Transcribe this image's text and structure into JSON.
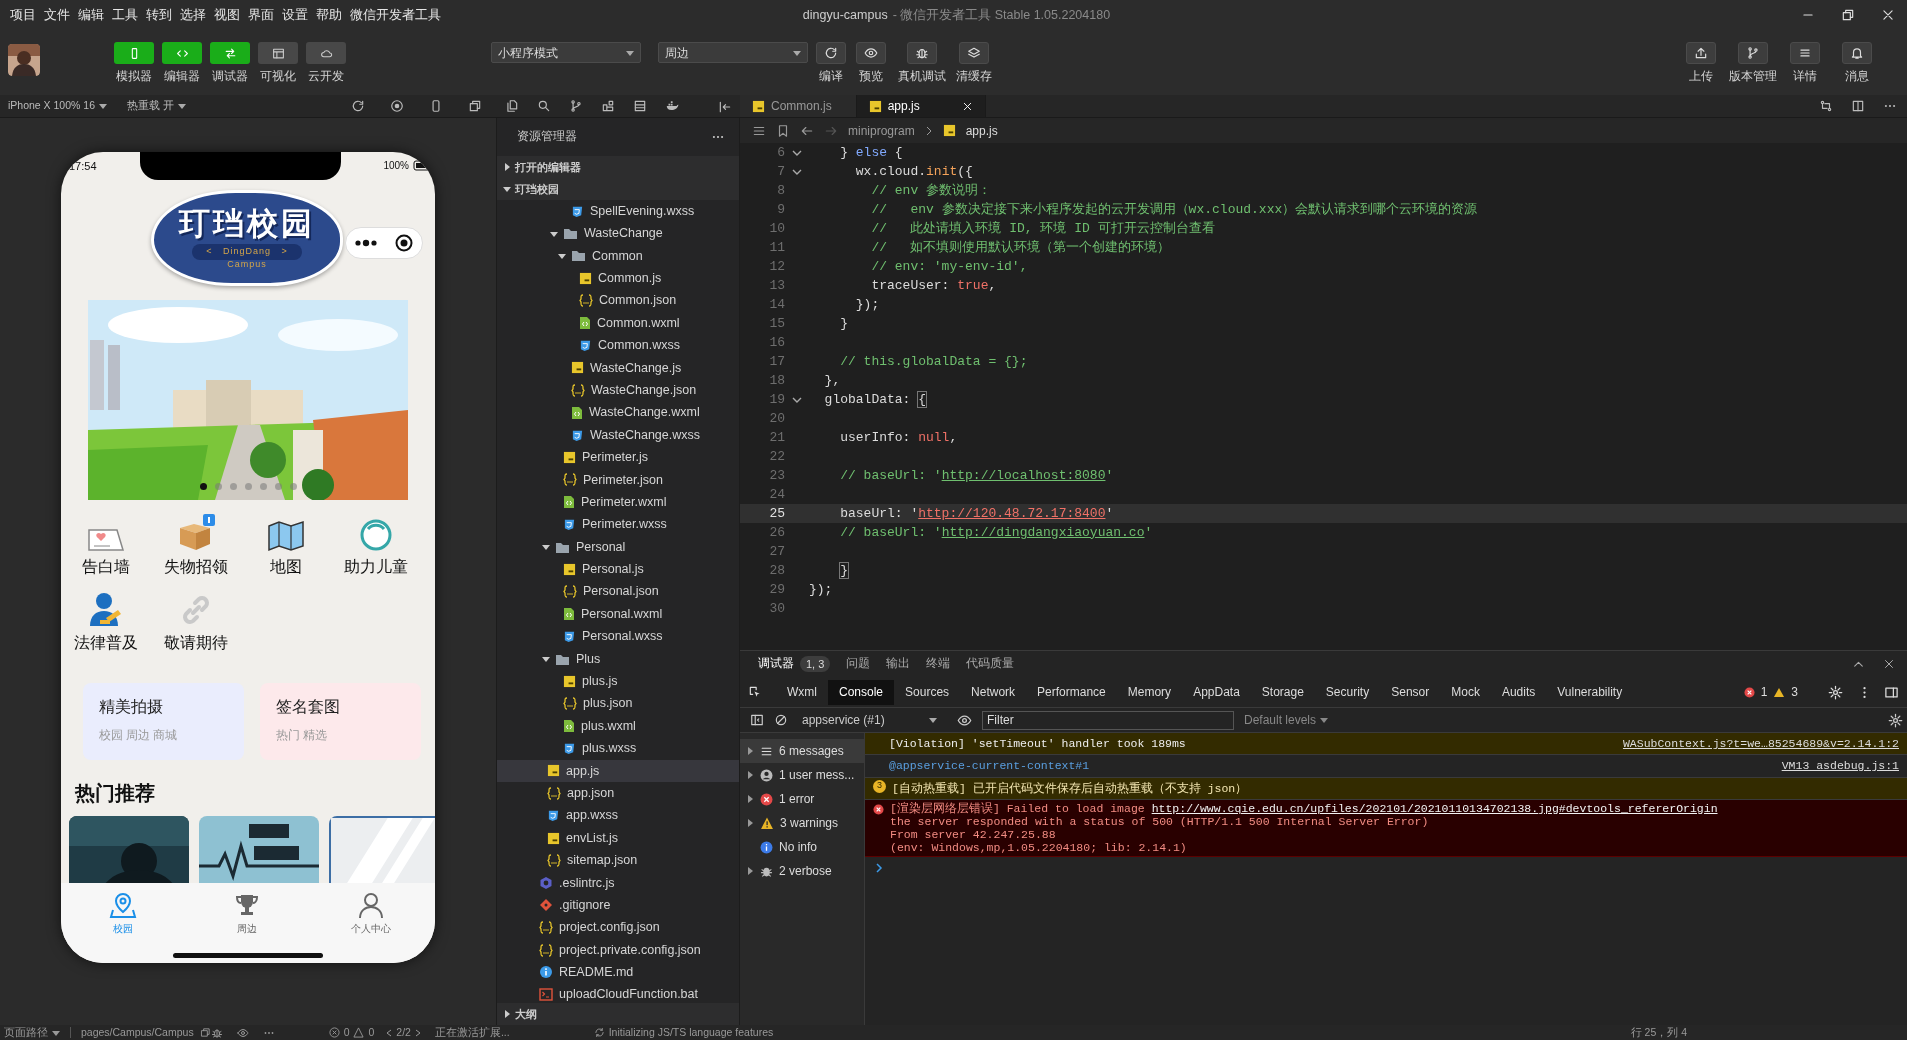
{
  "menu": [
    "项目",
    "文件",
    "编辑",
    "工具",
    "转到",
    "选择",
    "视图",
    "界面",
    "设置",
    "帮助",
    "微信开发者工具"
  ],
  "window": {
    "title": "dingyu-campus",
    "subtitle": "- 微信开发者工具 Stable 1.05.2204180"
  },
  "toolbar": {
    "modes": [
      {
        "label": "模拟器",
        "on": true
      },
      {
        "label": "编辑器",
        "on": true
      },
      {
        "label": "调试器",
        "on": true
      },
      {
        "label": "可视化",
        "on": false
      },
      {
        "label": "云开发",
        "on": false
      }
    ],
    "selects": [
      {
        "value": "小程序模式"
      },
      {
        "value": "周边"
      }
    ],
    "actions": [
      {
        "label": "编译"
      },
      {
        "label": "预览"
      },
      {
        "label": "真机调试"
      },
      {
        "label": "清缓存"
      }
    ],
    "right_actions": [
      {
        "label": "上传"
      },
      {
        "label": "版本管理"
      },
      {
        "label": "详情"
      },
      {
        "label": "消息"
      }
    ]
  },
  "simulator": {
    "device": "iPhone X 100% 16",
    "hot_reload": "热重载 开"
  },
  "phone": {
    "time": "17:54",
    "battery": "100%",
    "logo": {
      "title": "玎珰校园",
      "subtitle": "<   DingDang   >",
      "tagline": "Campus"
    },
    "banner": {
      "kind": "picture",
      "dots": [
        {
          "selected": true
        },
        {
          "selected": false
        },
        {
          "selected": false
        },
        {
          "selected": false
        },
        {
          "selected": false
        },
        {
          "selected": false
        },
        {
          "selected": false
        }
      ]
    },
    "grid": [
      {
        "label": "告白墙"
      },
      {
        "label": "失物招领"
      },
      {
        "label": "地图"
      },
      {
        "label": "助力儿童"
      },
      {
        "label": "法律普及"
      },
      {
        "label": "敬请期待"
      }
    ],
    "cards": [
      {
        "title": "精美拍摄",
        "tags": "校园 周边 商城",
        "color": "#eaedfd"
      },
      {
        "title": "签名套图",
        "tags": "热门 精选",
        "color": "#fde9eb"
      }
    ],
    "section_title": "热门推荐",
    "tabs": [
      {
        "label": "校园",
        "selected": true
      },
      {
        "label": "周边",
        "selected": false
      },
      {
        "label": "个人中心",
        "selected": false
      }
    ]
  },
  "explorer": {
    "title": "资源管理器",
    "sections": [
      {
        "label": "打开的编辑器",
        "expanded": false
      },
      {
        "label": "玎珰校园",
        "expanded": true
      }
    ],
    "tree": [
      {
        "kind": "group",
        "children": [
          {
            "kind": "group",
            "children": [
              {
                "kind": "group",
                "children": [
                  {
                    "kind": "group",
                    "children": [
                      {
                        "label": "SpellEvening.wxss",
                        "kind": "wxss",
                        "selected": false
                      }
                    ]
                  },
                  {
                    "label": "WasteChange",
                    "kind": "folder",
                    "expanded": true,
                    "selected": false,
                    "children": [
                      {
                        "label": "Common",
                        "kind": "folder",
                        "expanded": true,
                        "selected": false,
                        "children": [
                          {
                            "label": "Common.js",
                            "kind": "js",
                            "selected": false
                          },
                          {
                            "label": "Common.json",
                            "kind": "json",
                            "selected": false
                          },
                          {
                            "label": "Common.wxml",
                            "kind": "wxml",
                            "selected": false
                          },
                          {
                            "label": "Common.wxss",
                            "kind": "wxss",
                            "selected": false
                          }
                        ]
                      },
                      {
                        "label": "WasteChange.js",
                        "kind": "js",
                        "selected": false
                      },
                      {
                        "label": "WasteChange.json",
                        "kind": "json",
                        "selected": false
                      },
                      {
                        "label": "WasteChange.wxml",
                        "kind": "wxml",
                        "selected": false
                      },
                      {
                        "label": "WasteChange.wxss",
                        "kind": "wxss",
                        "selected": false
                      }
                    ]
                  },
                  {
                    "label": "Perimeter.js",
                    "kind": "js",
                    "selected": false
                  },
                  {
                    "label": "Perimeter.json",
                    "kind": "json",
                    "selected": false
                  },
                  {
                    "label": "Perimeter.wxml",
                    "kind": "wxml",
                    "selected": false
                  },
                  {
                    "label": "Perimeter.wxss",
                    "kind": "wxss",
                    "selected": false
                  }
                ]
              },
              {
                "label": "Personal",
                "kind": "folder",
                "expanded": true,
                "selected": false,
                "children": [
                  {
                    "label": "Personal.js",
                    "kind": "js",
                    "selected": false
                  },
                  {
                    "label": "Personal.json",
                    "kind": "json",
                    "selected": false
                  },
                  {
                    "label": "Personal.wxml",
                    "kind": "wxml",
                    "selected": false
                  },
                  {
                    "label": "Personal.wxss",
                    "kind": "wxss",
                    "selected": false
                  }
                ]
              },
              {
                "label": "Plus",
                "kind": "folder",
                "expanded": true,
                "selected": false,
                "children": [
                  {
                    "label": "plus.js",
                    "kind": "js",
                    "selected": false
                  },
                  {
                    "label": "plus.json",
                    "kind": "json",
                    "selected": false
                  },
                  {
                    "label": "plus.wxml",
                    "kind": "wxml",
                    "selected": false
                  },
                  {
                    "label": "plus.wxss",
                    "kind": "wxss",
                    "selected": false
                  }
                ]
              }
            ]
          },
          {
            "label": "app.js",
            "kind": "js",
            "selected": true
          },
          {
            "label": "app.json",
            "kind": "json",
            "selected": false
          },
          {
            "label": "app.wxss",
            "kind": "wxss",
            "selected": false
          },
          {
            "label": "envList.js",
            "kind": "js",
            "selected": false
          },
          {
            "label": "sitemap.json",
            "kind": "json",
            "selected": false
          }
        ]
      },
      {
        "label": ".eslintrc.js",
        "kind": "eslint",
        "selected": false
      },
      {
        "label": ".gitignore",
        "kind": "git",
        "selected": false
      },
      {
        "label": "project.config.json",
        "kind": "json",
        "selected": false
      },
      {
        "label": "project.private.config.json",
        "kind": "json",
        "selected": false
      },
      {
        "label": "README.md",
        "kind": "md",
        "selected": false
      },
      {
        "label": "uploadCloudFunction.bat",
        "kind": "bat",
        "selected": false
      }
    ],
    "outline": {
      "label": "大纲",
      "expanded": false
    }
  },
  "editor": {
    "tabs": [
      {
        "label": "Common.js",
        "selected": false
      },
      {
        "label": "app.js",
        "selected": true
      }
    ],
    "breadcrumb": [
      "miniprogram",
      "app.js"
    ],
    "lines": [
      {
        "num": "6",
        "fold": true,
        "current": false,
        "segs": [
          {
            "kind": "plain",
            "text": "    } "
          },
          {
            "kind": "keyword",
            "text": "else"
          },
          {
            "kind": "plain",
            "text": " {"
          }
        ]
      },
      {
        "num": "7",
        "fold": true,
        "current": false,
        "segs": [
          {
            "kind": "plain",
            "text": "      wx.cloud."
          },
          {
            "kind": "func",
            "text": "init"
          },
          {
            "kind": "plain",
            "text": "({"
          }
        ]
      },
      {
        "num": "8",
        "fold": false,
        "current": false,
        "segs": [
          {
            "kind": "comment",
            "text": "        // env 参数说明："
          }
        ]
      },
      {
        "num": "9",
        "fold": false,
        "current": false,
        "segs": [
          {
            "kind": "comment",
            "text": "        //   env 参数决定接下来小程序发起的云开发调用（wx.cloud.xxx）会默认请求到哪个云环境的资源"
          }
        ]
      },
      {
        "num": "10",
        "fold": false,
        "current": false,
        "segs": [
          {
            "kind": "comment",
            "text": "        //   此处请填入环境 ID, 环境 ID 可打开云控制台查看"
          }
        ]
      },
      {
        "num": "11",
        "fold": false,
        "current": false,
        "segs": [
          {
            "kind": "comment",
            "text": "        //   如不填则使用默认环境（第一个创建的环境）"
          }
        ]
      },
      {
        "num": "12",
        "fold": false,
        "current": false,
        "segs": [
          {
            "kind": "comment",
            "text": "        // env: 'my-env-id',"
          }
        ]
      },
      {
        "num": "13",
        "fold": false,
        "current": false,
        "segs": [
          {
            "kind": "plain",
            "text": "        traceUser: "
          },
          {
            "kind": "literal",
            "text": "true"
          },
          {
            "kind": "plain",
            "text": ","
          }
        ]
      },
      {
        "num": "14",
        "fold": false,
        "current": false,
        "segs": [
          {
            "kind": "plain",
            "text": "      });"
          }
        ]
      },
      {
        "num": "15",
        "fold": false,
        "current": false,
        "segs": [
          {
            "kind": "plain",
            "text": "    }"
          }
        ]
      },
      {
        "num": "16",
        "fold": false,
        "current": false
      },
      {
        "num": "17",
        "fold": false,
        "current": false,
        "segs": [
          {
            "kind": "comment",
            "text": "    // this.globalData = {};"
          }
        ]
      },
      {
        "num": "18",
        "fold": false,
        "current": false,
        "segs": [
          {
            "kind": "plain",
            "text": "  },"
          }
        ]
      },
      {
        "num": "19",
        "fold": true,
        "current": false,
        "segs": [
          {
            "kind": "plain",
            "text": "  globalData: "
          },
          {
            "kind": "bracket",
            "text": "{"
          }
        ]
      },
      {
        "num": "20",
        "fold": false,
        "current": false
      },
      {
        "num": "21",
        "fold": false,
        "current": false,
        "segs": [
          {
            "kind": "plain",
            "text": "    userInfo: "
          },
          {
            "kind": "literal",
            "text": "null"
          },
          {
            "kind": "plain",
            "text": ","
          }
        ]
      },
      {
        "num": "22",
        "fold": false,
        "current": false
      },
      {
        "num": "23",
        "fold": false,
        "current": false,
        "segs": [
          {
            "kind": "comment",
            "text": "    // baseUrl: '"
          },
          {
            "kind": "comment_link",
            "text": "http://localhost:8080"
          },
          {
            "kind": "comment",
            "text": "'"
          }
        ]
      },
      {
        "num": "24",
        "fold": false,
        "current": false
      },
      {
        "num": "25",
        "fold": false,
        "current": true,
        "segs": [
          {
            "kind": "plain",
            "text": "    baseUrl: '"
          },
          {
            "kind": "string_link",
            "text": "http://120.48.72.17:8400"
          },
          {
            "kind": "plain",
            "text": "'"
          }
        ]
      },
      {
        "num": "26",
        "fold": false,
        "current": false,
        "segs": [
          {
            "kind": "comment",
            "text": "    // baseUrl: '"
          },
          {
            "kind": "comment_link",
            "text": "http://dingdangxiaoyuan.co"
          },
          {
            "kind": "comment",
            "text": "'"
          }
        ]
      },
      {
        "num": "27",
        "fold": false,
        "current": false
      },
      {
        "num": "28",
        "fold": false,
        "current": false,
        "segs": [
          {
            "kind": "bracket",
            "text": "    }"
          }
        ]
      },
      {
        "num": "29",
        "fold": false,
        "current": false,
        "segs": [
          {
            "kind": "plain",
            "text": "});"
          }
        ]
      },
      {
        "num": "30",
        "fold": false,
        "current": false
      }
    ]
  },
  "panel": {
    "tabs": [
      {
        "label": "调试器",
        "selected": true,
        "badge": "1, 3"
      },
      {
        "label": "问题",
        "selected": false
      },
      {
        "label": "输出",
        "selected": false
      },
      {
        "label": "终端",
        "selected": false
      },
      {
        "label": "代码质量",
        "selected": false
      }
    ]
  },
  "devtools": {
    "tabs": [
      {
        "label": "Wxml",
        "selected": false
      },
      {
        "label": "Console",
        "selected": true
      },
      {
        "label": "Sources",
        "selected": false
      },
      {
        "label": "Network",
        "selected": false
      },
      {
        "label": "Performance",
        "selected": false
      },
      {
        "label": "Memory",
        "selected": false
      },
      {
        "label": "AppData",
        "selected": false
      },
      {
        "label": "Storage",
        "selected": false
      },
      {
        "label": "Security",
        "selected": false
      },
      {
        "label": "Sensor",
        "selected": false
      },
      {
        "label": "Mock",
        "selected": false
      },
      {
        "label": "Audits",
        "selected": false
      },
      {
        "label": "Vulnerability",
        "selected": false
      }
    ],
    "errors": "1",
    "warnings": "3",
    "context": "appservice (#1)",
    "filter_placeholder": "Filter",
    "levels": "Default levels",
    "sidebar": [
      {
        "kind": "list",
        "label": "6 messages",
        "selected": true,
        "expandable": true
      },
      {
        "kind": "user",
        "label": "1 user mess...",
        "selected": false,
        "expandable": true
      },
      {
        "kind": "error",
        "label": "1 error",
        "selected": false,
        "expandable": true
      },
      {
        "kind": "warning",
        "label": "3 warnings",
        "selected": false,
        "expandable": true
      },
      {
        "kind": "info",
        "label": "No info",
        "selected": false,
        "expandable": false
      },
      {
        "kind": "verbose",
        "label": "2 verbose",
        "selected": false,
        "expandable": true
      }
    ],
    "messages": [
      {
        "kind": "violation",
        "text": "[Violation] 'setTimeout' handler took 189ms",
        "source": "WASubContext.js?t=we…85254689&v=2.14.1:2"
      },
      {
        "kind": "context",
        "text": "@appservice-current-context#1",
        "source": "VM13 asdebug.js:1"
      },
      {
        "kind": "warning",
        "count": "3",
        "text": "[自动热重载] 已开启代码文件保存后自动热重载（不支持 json）"
      },
      {
        "kind": "error",
        "text": "[渲染层网络层错误] Failed to load image ",
        "link": "http://www.cqie.edu.cn/upfiles/202101/20210110134702138.jpg#devtools_refererOrigin",
        "details": [
          "the server responded with a status of 500 (HTTP/1.1 500 Internal Server Error)",
          "From server 42.247.25.88",
          "(env: Windows,mp,1.05.2204180; lib: 2.14.1)"
        ]
      }
    ]
  },
  "status_bar": {
    "page_path_label": "页面路径",
    "page_path": "pages/Campus/Campus",
    "errors": "0",
    "warnings": "0",
    "pager": "2/2",
    "activity": "正在激活扩展...",
    "language": "Initializing JS/TS language features",
    "position": "行 25，列 4"
  }
}
